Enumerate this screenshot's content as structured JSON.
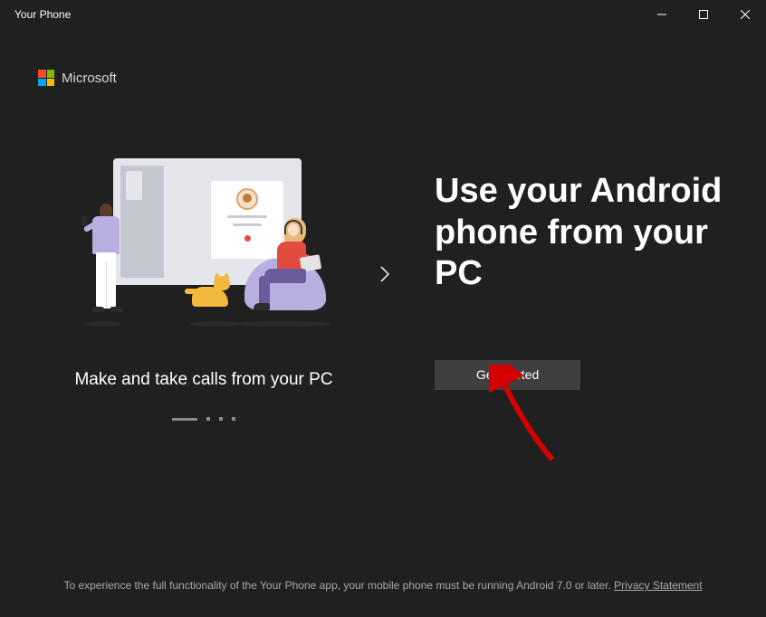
{
  "window": {
    "title": "Your Phone"
  },
  "brand": {
    "name": "Microsoft"
  },
  "carousel": {
    "slide_caption": "Make and take calls from your PC",
    "active_index": 0,
    "total": 4
  },
  "heading": "Use your Android phone from your PC",
  "cta": {
    "get_started_label": "Get started"
  },
  "footer": {
    "text": "To experience the full functionality of the Your Phone app, your mobile phone must be running Android 7.0 or later. ",
    "privacy_label": "Privacy Statement"
  }
}
